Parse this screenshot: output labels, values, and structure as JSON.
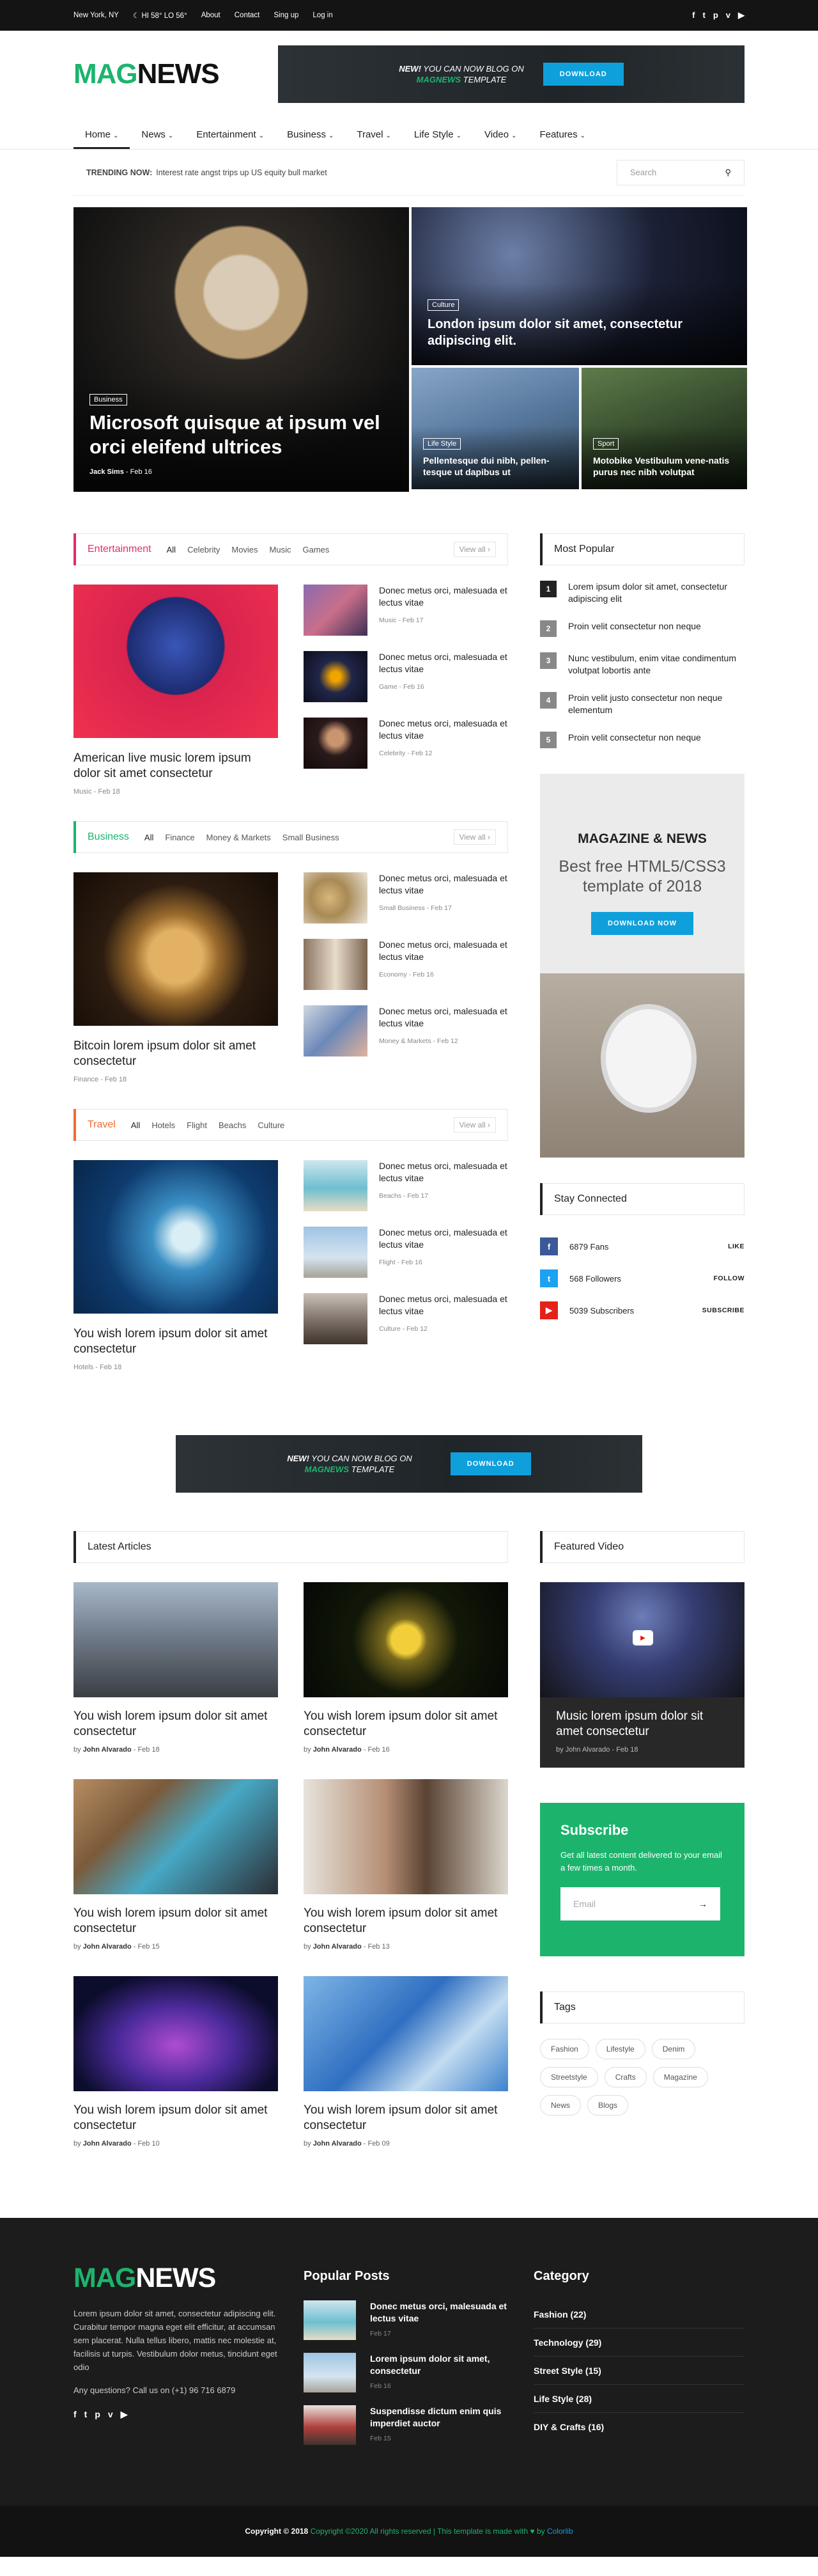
{
  "topbar": {
    "location": "New York, NY",
    "weather": "HI 58° LO 56°",
    "links": [
      "About",
      "Contact",
      "Sing up",
      "Log in"
    ],
    "social": [
      "f",
      "t",
      "p",
      "v",
      "yt"
    ]
  },
  "header": {
    "logo_a": "MAG",
    "logo_b": "NEWS",
    "banner": {
      "line1_bold": "NEW!",
      "line1": " YOU CAN NOW BLOG ON",
      "line2_brand": "MAGNEWS",
      "line2": " TEMPLATE",
      "button": "DOWNLOAD"
    }
  },
  "nav": {
    "items": [
      "Home",
      "News",
      "Entertainment",
      "Business",
      "Travel",
      "Life Style",
      "Video",
      "Features"
    ]
  },
  "trending": {
    "label": "TRENDING NOW:",
    "text": "Interest rate angst trips up US equity bull market",
    "search_placeholder": "Search"
  },
  "hero": {
    "main": {
      "tag": "Business",
      "title": "Microsoft quisque at ipsum vel orci eleifend ultrices",
      "author": "Jack Sims",
      "date": "Feb 16"
    },
    "r1": {
      "tag": "Culture",
      "title": "London ipsum dolor sit amet, consectetur adipiscing elit."
    },
    "r2a": {
      "tag": "Life Style",
      "title": "Pellentesque dui nibh, pellen-tesque ut dapibus ut"
    },
    "r2b": {
      "tag": "Sport",
      "title": "Motobike Vestibulum vene-natis purus nec nibh volutpat"
    }
  },
  "sections": [
    {
      "title": "Entertainment",
      "color": "#e52a6d",
      "tabs": [
        "All",
        "Celebrity",
        "Movies",
        "Music",
        "Games"
      ],
      "view_all": "View all",
      "feat": {
        "title": "American live music lorem ipsum dolor sit amet consectetur",
        "cat": "Music",
        "date": "Feb 18"
      },
      "items": [
        {
          "title": "Donec metus orci, malesuada et lectus vitae",
          "cat": "Music",
          "date": "Feb 17"
        },
        {
          "title": "Donec metus orci, malesuada et lectus vitae",
          "cat": "Game",
          "date": "Feb 16"
        },
        {
          "title": "Donec metus orci, malesuada et lectus vitae",
          "cat": "Celebrity",
          "date": "Feb 12"
        }
      ]
    },
    {
      "title": "Business",
      "color": "#1cb46d",
      "tabs": [
        "All",
        "Finance",
        "Money & Markets",
        "Small Business"
      ],
      "view_all": "View all",
      "feat": {
        "title": "Bitcoin lorem ipsum dolor sit amet consectetur",
        "cat": "Finance",
        "date": "Feb 18"
      },
      "items": [
        {
          "title": "Donec metus orci, malesuada et lectus vitae",
          "cat": "Small Business",
          "date": "Feb 17"
        },
        {
          "title": "Donec metus orci, malesuada et lectus vitae",
          "cat": "Economy",
          "date": "Feb 16"
        },
        {
          "title": "Donec metus orci, malesuada et lectus vitae",
          "cat": "Money & Markets",
          "date": "Feb 12"
        }
      ]
    },
    {
      "title": "Travel",
      "color": "#f06d30",
      "tabs": [
        "All",
        "Hotels",
        "Flight",
        "Beachs",
        "Culture"
      ],
      "view_all": "View all",
      "feat": {
        "title": "You wish lorem ipsum dolor sit amet consectetur",
        "cat": "Hotels",
        "date": "Feb 18"
      },
      "items": [
        {
          "title": "Donec metus orci, malesuada et lectus vitae",
          "cat": "Beachs",
          "date": "Feb 17"
        },
        {
          "title": "Donec metus orci, malesuada et lectus vitae",
          "cat": "Flight",
          "date": "Feb 16"
        },
        {
          "title": "Donec metus orci, malesuada et lectus vitae",
          "cat": "Culture",
          "date": "Feb 12"
        }
      ]
    }
  ],
  "popular": {
    "title": "Most Popular",
    "items": [
      "Lorem ipsum dolor sit amet, consectetur adipiscing elit",
      "Proin velit consectetur non neque",
      "Nunc vestibulum, enim vitae condimentum volutpat lobortis ante",
      "Proin velit justo consectetur non neque elementum",
      "Proin velit consectetur non neque"
    ]
  },
  "side_ad": {
    "title": "MAGAZINE & NEWS",
    "subtitle": "Best free HTML5/CSS3 template of 2018",
    "button": "DOWNLOAD NOW"
  },
  "connected": {
    "title": "Stay Connected",
    "rows": [
      {
        "icon": "f",
        "count": "6879 Fans",
        "action": "LIKE",
        "color": "#3b5998"
      },
      {
        "icon": "t",
        "count": "568 Followers",
        "action": "FOLLOW",
        "color": "#1da1f2"
      },
      {
        "icon": "▶",
        "count": "5039 Subscribers",
        "action": "SUBSCRIBE",
        "color": "#e62117"
      }
    ]
  },
  "latest": {
    "title": "Latest Articles",
    "cards": [
      {
        "title": "You wish lorem ipsum dolor sit amet consectetur",
        "author": "John Alvarado",
        "date": "Feb 18"
      },
      {
        "title": "You wish lorem ipsum dolor sit amet consectetur",
        "author": "John Alvarado",
        "date": "Feb 16"
      },
      {
        "title": "You wish lorem ipsum dolor sit amet consectetur",
        "author": "John Alvarado",
        "date": "Feb 15"
      },
      {
        "title": "You wish lorem ipsum dolor sit amet consectetur",
        "author": "John Alvarado",
        "date": "Feb 13"
      },
      {
        "title": "You wish lorem ipsum dolor sit amet consectetur",
        "author": "John Alvarado",
        "date": "Feb 10"
      },
      {
        "title": "You wish lorem ipsum dolor sit amet consectetur",
        "author": "John Alvarado",
        "date": "Feb 09"
      }
    ]
  },
  "featured_video": {
    "title": "Featured Video",
    "caption": "Music lorem ipsum dolor sit amet consectetur",
    "author": "John Alvarado",
    "date": "Feb 18"
  },
  "subscribe": {
    "title": "Subscribe",
    "text": "Get all latest content delivered to your email a few times a month.",
    "placeholder": "Email"
  },
  "tags": {
    "title": "Tags",
    "items": [
      "Fashion",
      "Lifestyle",
      "Denim",
      "Streetstyle",
      "Crafts",
      "Magazine",
      "News",
      "Blogs"
    ]
  },
  "footer": {
    "about": "Lorem ipsum dolor sit amet, consectetur adipiscing elit. Curabitur tempor magna eget elit efficitur, at accumsan sem placerat. Nulla tellus libero, mattis nec molestie at, facilisis ut turpis. Vestibulum dolor metus, tincidunt eget odio",
    "ask": "Any questions? Call us on (+1) 96 716 6879",
    "popular_title": "Popular Posts",
    "posts": [
      {
        "title": "Donec metus orci, malesuada et lectus vitae",
        "date": "Feb 17"
      },
      {
        "title": "Lorem ipsum dolor sit amet, consectetur",
        "date": "Feb 16"
      },
      {
        "title": "Suspendisse dictum enim quis imperdiet auctor",
        "date": "Feb 15"
      }
    ],
    "category_title": "Category",
    "categories": [
      "Fashion (22)",
      "Technology (29)",
      "Street Style (15)",
      "Life Style (28)",
      "DIY & Crafts (16)"
    ],
    "copy_a": "Copyright © 2018",
    "copy_b": "Copyright ©2020 All rights reserved | This template is made with",
    "copy_c": "by",
    "copy_d": "Colorlib"
  }
}
